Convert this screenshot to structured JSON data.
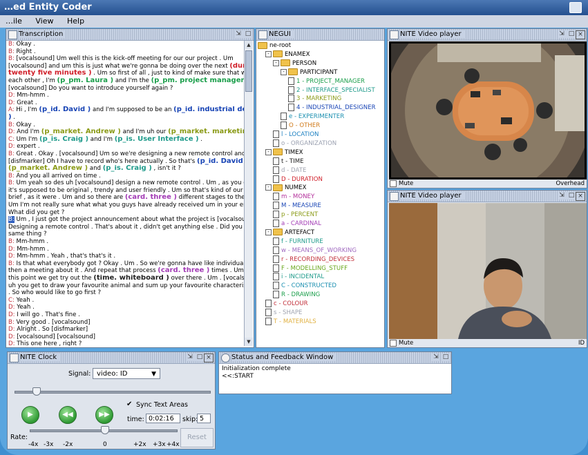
{
  "window": {
    "title": "…ed Entity Coder"
  },
  "menu": [
    "…ile",
    "View",
    "Help"
  ],
  "panels": {
    "transcription": "Transcription",
    "negui": "NEGUI",
    "video1": "NITE Video player",
    "video2": "NITE Video player",
    "clock": "NITE Clock",
    "status": "Status and Feedback Window"
  },
  "transcript": [
    [
      [
        "sp",
        "B:"
      ],
      [
        "t",
        " Okay ."
      ]
    ],
    [
      [
        "sp",
        "B:"
      ],
      [
        "t",
        " Right ."
      ]
    ],
    [
      [
        "sp",
        "B:"
      ],
      [
        "t",
        " [vocalsound] Um well this is the kick-off meeting for our our project . Um"
      ]
    ],
    [
      [
        "t",
        "[vocalsound] and um this is just what we're gonna be doing over the next "
      ],
      [
        "tag t-dur",
        "(dur."
      ]
    ],
    [
      [
        "tag t-dur",
        "twenty five minutes )"
      ],
      [
        "t",
        " . Um so first of all , just to kind of make sure that we all know"
      ]
    ],
    [
      [
        "t",
        "each other , I'm "
      ],
      [
        "tag t-pm",
        "(p_pm. Laura )"
      ],
      [
        "t",
        " and I'm the "
      ],
      [
        "tag t-pm",
        "(p_pm. project manager )"
      ],
      [
        "t",
        " ."
      ]
    ],
    [
      [
        "t",
        "[vocalsound] Do you want to introduce yourself again ?"
      ]
    ],
    [
      [
        "sp",
        "D:"
      ],
      [
        "t",
        " Mm-hmm ."
      ]
    ],
    [
      [
        "sp",
        "D:"
      ],
      [
        "t",
        " Great ."
      ]
    ],
    [
      [
        "sp",
        "A:"
      ],
      [
        "t",
        " Hi , I'm "
      ],
      [
        "tag t-id",
        "(p_id. David )"
      ],
      [
        "t",
        " and I'm supposed to be an "
      ],
      [
        "tag t-id",
        "(p_id. industrial designer"
      ]
    ],
    [
      [
        "tag t-id",
        ")"
      ],
      [
        "t",
        " ."
      ]
    ],
    [
      [
        "sp",
        "B:"
      ],
      [
        "t",
        " Okay ."
      ]
    ],
    [
      [
        "sp",
        "D:"
      ],
      [
        "t",
        " And I'm "
      ],
      [
        "tag t-mk",
        "(p_market. Andrew )"
      ],
      [
        "t",
        " and I'm uh our "
      ],
      [
        "tag t-mk",
        "(p_market. marketing )"
      ]
    ],
    [
      [
        "sp",
        "C:"
      ],
      [
        "t",
        " Um I'm "
      ],
      [
        "tag t-is",
        "(p_is. Craig )"
      ],
      [
        "t",
        " and I'm "
      ],
      [
        "tag t-is",
        "(p_is. User Interface )"
      ],
      [
        "t",
        " ."
      ]
    ],
    [
      [
        "sp",
        "D:"
      ],
      [
        "t",
        " expert ."
      ]
    ],
    [
      [
        "sp",
        "B:"
      ],
      [
        "t",
        " Great . Okay . [vocalsound] Um so we're designing a new remote control and um"
      ]
    ],
    [
      [
        "t",
        "[disfmarker] Oh I have to record who's here actually . So that's "
      ],
      [
        "tag t-id",
        "(p_id. David )"
      ],
      [
        "t",
        " ,"
      ]
    ],
    [
      [
        "tag t-mk",
        "(p_market. Andrew )"
      ],
      [
        "t",
        " and "
      ],
      [
        "tag t-is",
        "(p_is. Craig )"
      ],
      [
        "t",
        " , isn't it ?"
      ]
    ],
    [
      [
        "sp",
        "B:"
      ],
      [
        "t",
        " And you all arrived on time ."
      ]
    ],
    [
      [
        "sp",
        "B:"
      ],
      [
        "t",
        " Um yeah so des uh [vocalsound] design a new remote control . Um , as you can see"
      ]
    ],
    [
      [
        "t",
        "it's supposed to be original , trendy and user friendly . Um so that's kind of our our"
      ]
    ],
    [
      [
        "t",
        "brief , as it were . Um and so there are "
      ],
      [
        "tag t-card",
        "(card. three )"
      ],
      [
        "t",
        " different stages to the design ."
      ]
    ],
    [
      [
        "t",
        "Um I'm not really sure what what you guys have already received um in your emails ."
      ]
    ],
    [
      [
        "t",
        "What did you get ?"
      ]
    ],
    [
      [
        "sel",
        "B:"
      ],
      [
        "t",
        " Um , I just got the project announcement about what the project is [vocalsound] ."
      ]
    ],
    [
      [
        "t",
        "Designing a remote control . That's about it , didn't get anything else . Did you get the"
      ]
    ],
    [
      [
        "t",
        "same thing ?"
      ]
    ],
    [
      [
        "sp",
        "B:"
      ],
      [
        "t",
        " Mm-hmm ."
      ]
    ],
    [
      [
        "sp",
        "D:"
      ],
      [
        "t",
        " Mm-hmm ."
      ]
    ],
    [
      [
        "sp",
        "D:"
      ],
      [
        "t",
        " Mm-hmm . Yeah , that's that's it ."
      ]
    ],
    [
      [
        "sp",
        "B:"
      ],
      [
        "t",
        " Is that what everybody got ? Okay . Um . So we're gonna have like individual work and"
      ]
    ],
    [
      [
        "t",
        "then a meeting about it . And repeat that process "
      ],
      [
        "tag t-card",
        "(card. three )"
      ],
      [
        "t",
        " times . Um and at"
      ]
    ],
    [
      [
        "t",
        "this point we get try out the "
      ],
      [
        "tag t-wb",
        "(time. whiteboard )"
      ],
      [
        "t",
        " over there . Um . [vocalsound] So"
      ]
    ],
    [
      [
        "t",
        "uh you get to draw your favourite animal and sum up your favourite characteristics of it"
      ]
    ],
    [
      [
        "t",
        ". So who would like to go first ?"
      ]
    ],
    [
      [
        "sp",
        "C:"
      ],
      [
        "t",
        " Yeah ."
      ]
    ],
    [
      [
        "sp",
        "D:"
      ],
      [
        "t",
        " Yeah ."
      ]
    ],
    [
      [
        "sp",
        "D:"
      ],
      [
        "t",
        " I will go . That's fine ."
      ]
    ],
    [
      [
        "sp",
        "B:"
      ],
      [
        "t",
        " Very good . [vocalsound]"
      ]
    ],
    [
      [
        "sp",
        "D:"
      ],
      [
        "t",
        " Alright . So [disfmarker]"
      ]
    ],
    [
      [
        "sp",
        "D:"
      ],
      [
        "t",
        " [vocalsound] [vocalsound]"
      ]
    ],
    [
      [
        "sp",
        "D:"
      ],
      [
        "t",
        " This one here , right ?"
      ]
    ],
    [
      [
        "sp",
        "B:"
      ],
      [
        "t",
        " Mm-hmm ."
      ]
    ]
  ],
  "tree": [
    {
      "label": "ne-root",
      "level": 0,
      "kind": "folder",
      "color": "#000000"
    },
    {
      "label": "ENAMEX",
      "level": 1,
      "kind": "folder",
      "color": "#000000"
    },
    {
      "label": "PERSON",
      "level": 2,
      "kind": "folder",
      "color": "#000000"
    },
    {
      "label": "PARTICIPANT",
      "level": 3,
      "kind": "folder",
      "color": "#000000"
    },
    {
      "label": "1 - PROJECT_MANAGER",
      "level": 4,
      "kind": "file",
      "color": "#1a9e4a"
    },
    {
      "label": "2 - INTERFACE_SPECIALIST",
      "level": 4,
      "kind": "file",
      "color": "#1e9a8a"
    },
    {
      "label": "3 - MARKETING",
      "level": 4,
      "kind": "file",
      "color": "#8a9a16"
    },
    {
      "label": "4 - INDUSTRIAL_DESIGNER",
      "level": 4,
      "kind": "file",
      "color": "#1844b5"
    },
    {
      "label": "e - EXPERIMENTER",
      "level": 3,
      "kind": "file",
      "color": "#1a8fb0"
    },
    {
      "label": "O - OTHER",
      "level": 3,
      "kind": "file",
      "color": "#d07a1a"
    },
    {
      "label": "l - LOCATION",
      "level": 2,
      "kind": "file",
      "color": "#1a7fc0"
    },
    {
      "label": "o - ORGANIZATION",
      "level": 2,
      "kind": "file",
      "color": "#9aa0b0"
    },
    {
      "label": "TIMEX",
      "level": 1,
      "kind": "folder",
      "color": "#000000"
    },
    {
      "label": "t - TIME",
      "level": 2,
      "kind": "file",
      "color": "#222222"
    },
    {
      "label": "d - DATE",
      "level": 2,
      "kind": "file",
      "color": "#a0a4b0"
    },
    {
      "label": "D - DURATION",
      "level": 2,
      "kind": "file",
      "color": "#d0202a"
    },
    {
      "label": "NUMEX",
      "level": 1,
      "kind": "folder",
      "color": "#000000"
    },
    {
      "label": "m - MONEY",
      "level": 2,
      "kind": "file",
      "color": "#b22d9a"
    },
    {
      "label": "M - MEASURE",
      "level": 2,
      "kind": "file",
      "color": "#1844b5"
    },
    {
      "label": "p - PERCENT",
      "level": 2,
      "kind": "file",
      "color": "#8a9a16"
    },
    {
      "label": "a - CARDINAL",
      "level": 2,
      "kind": "file",
      "color": "#a23bb5"
    },
    {
      "label": "ARTEFACT",
      "level": 1,
      "kind": "folder",
      "color": "#000000"
    },
    {
      "label": "f - FURNITURE",
      "level": 2,
      "kind": "file",
      "color": "#1e9a8a"
    },
    {
      "label": "w - MEANS_OF_WORKING",
      "level": 2,
      "kind": "file",
      "color": "#a06ac0"
    },
    {
      "label": "r - RECORDING_DEVICES",
      "level": 2,
      "kind": "file",
      "color": "#c2303a"
    },
    {
      "label": "F - MODELLING_STUFF",
      "level": 2,
      "kind": "file",
      "color": "#6aa81e"
    },
    {
      "label": "i - INCIDENTAL",
      "level": 2,
      "kind": "file",
      "color": "#1e9a8a"
    },
    {
      "label": "C - CONSTRUCTED",
      "level": 2,
      "kind": "file",
      "color": "#1a8fb0"
    },
    {
      "label": "R - DRAWING",
      "level": 2,
      "kind": "file",
      "color": "#1a9e4a"
    },
    {
      "label": "c - COLOUR",
      "level": 1,
      "kind": "file",
      "color": "#c2303a"
    },
    {
      "label": "s - SHAPE",
      "level": 1,
      "kind": "file",
      "color": "#a0a4b0"
    },
    {
      "label": "T - MATERIALS",
      "level": 1,
      "kind": "file",
      "color": "#e0b040"
    }
  ],
  "video1_footer": {
    "mute": "Mute",
    "camera": "Overhead"
  },
  "video2_footer": {
    "mute": "Mute",
    "camera": "ID"
  },
  "clock": {
    "signal_label": "Signal:",
    "signal_value": "video: ID",
    "sync_label": "Sync Text Areas",
    "time_label": "time:",
    "time_value": "0:02:16",
    "skip_label": "skip:",
    "skip_value": "5",
    "rate_label": "Rate:",
    "rate_ticks": [
      "-4x",
      "-3x",
      "-2x",
      "0",
      "+2x",
      "+3x",
      "+4x"
    ],
    "reset": "Reset"
  },
  "status_lines": [
    "Initialization complete",
    "<<:START"
  ]
}
